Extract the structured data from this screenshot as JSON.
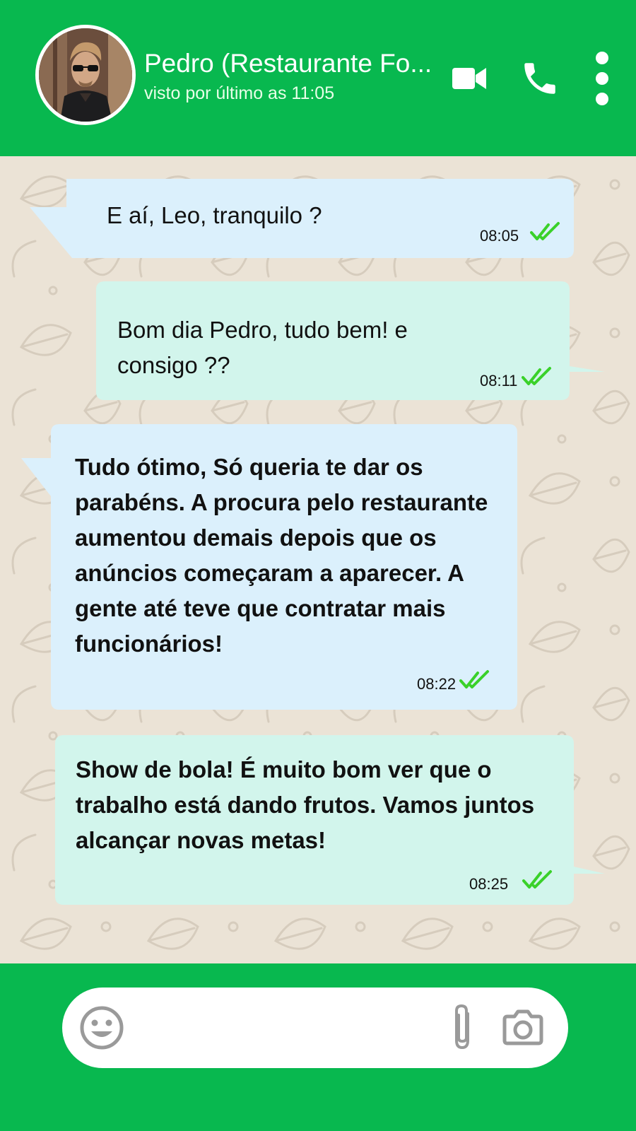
{
  "header": {
    "contact_name": "Pedro (Restaurante Fo...",
    "last_seen": "visto por último as 11:05",
    "icons": [
      "avatar-photo",
      "video-call-icon",
      "phone-call-icon",
      "more-options-icon"
    ]
  },
  "messages": [
    {
      "text": "E aí, Leo, tranquilo ?",
      "time": "08:05",
      "status": "read"
    },
    {
      "text": "Bom dia Pedro, tudo bem! e consigo ??",
      "time": "08:11",
      "status": "read"
    },
    {
      "text": "Tudo ótimo, Só queria te dar os parabéns. A procura pelo restaurante aumentou demais depois que os anúncios começaram a aparecer. A gente até teve que contratar mais funcionários!",
      "time": "08:22",
      "status": "read"
    },
    {
      "text": "Show de bola! É muito bom ver que o trabalho está dando frutos. Vamos juntos alcançar novas metas!",
      "time": "08:25",
      "status": "read"
    }
  ],
  "composer": {
    "value": "",
    "icons": [
      "emoji-icon",
      "attach-clip-icon",
      "camera-icon"
    ]
  },
  "colors": {
    "bar_green": "#08b84f",
    "chat_background": "#ebe3d6",
    "bubble_incoming": "#dbf0fc",
    "bubble_outgoing": "#d2f5ec",
    "read_tick": "#3ad12a"
  }
}
